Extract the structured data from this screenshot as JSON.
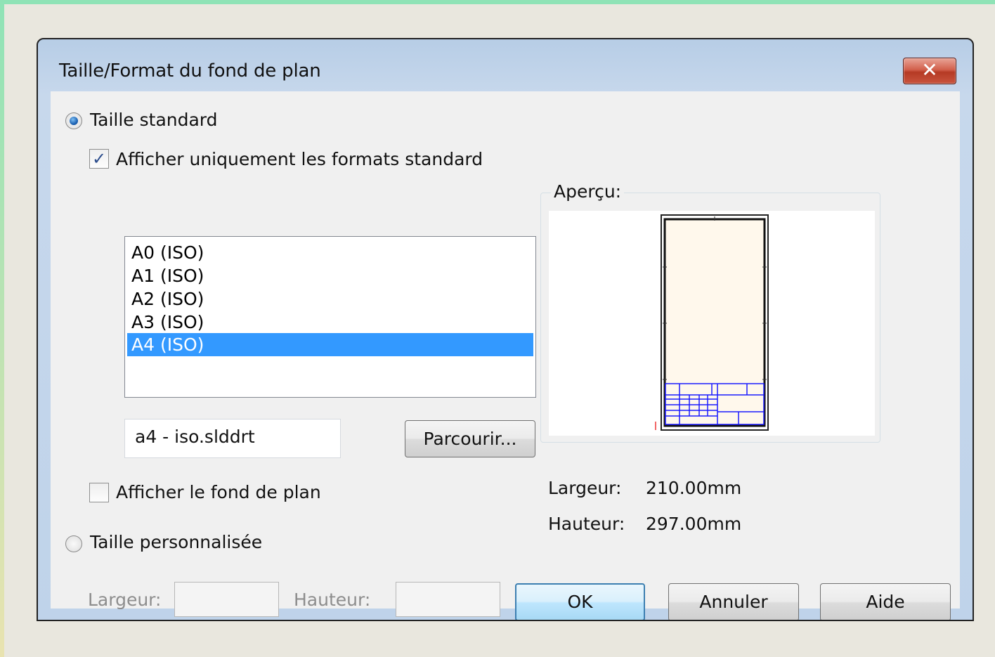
{
  "window": {
    "title": "Taille/Format du fond de plan",
    "close_glyph": "✕"
  },
  "standard": {
    "radio_label": "Taille standard",
    "radio_selected": true,
    "show_standard_only_label": "Afficher uniquement les formats standard",
    "show_standard_only_checked": true,
    "formats": [
      "A0 (ISO)",
      "A1 (ISO)",
      "A2 (ISO)",
      "A3 (ISO)",
      "A4 (ISO)"
    ],
    "selected_format": "A4 (ISO)",
    "file_value": "a4 - iso.slddrt",
    "browse_label": "Parcourir...",
    "show_sheet_label": "Afficher le fond de plan",
    "show_sheet_checked": false
  },
  "preview": {
    "group_label": "Aperçu:",
    "width_label": "Largeur:",
    "width_value": "210.00mm",
    "height_label": "Hauteur:",
    "height_value": "297.00mm"
  },
  "custom": {
    "radio_label": "Taille personnalisée",
    "radio_selected": false,
    "width_label": "Largeur:",
    "height_label": "Hauteur:",
    "width_value": "",
    "height_value": ""
  },
  "buttons": {
    "ok": "OK",
    "cancel": "Annuler",
    "help": "Aide"
  },
  "colors": {
    "selection": "#3399ff",
    "preview_border": "#1a1aff"
  }
}
